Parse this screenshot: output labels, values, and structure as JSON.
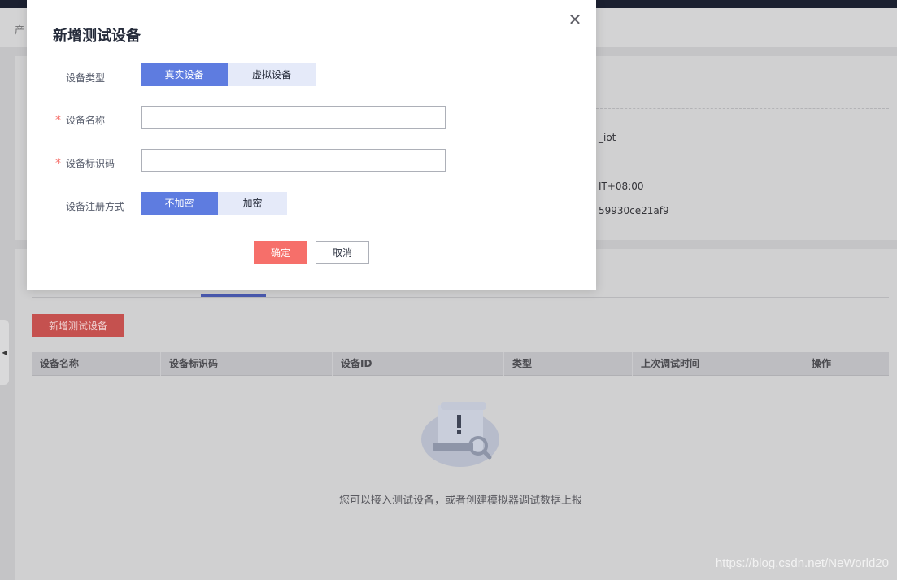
{
  "background": {
    "breadcrumb": "产",
    "info_lines": [
      "_iot",
      "IT+08:00",
      "59930ce21af9"
    ],
    "add_test_device_button": "新增测试设备",
    "table_headers": [
      "设备名称",
      "设备标识码",
      "设备ID",
      "类型",
      "上次调试时间",
      "操作"
    ],
    "empty_text": "您可以接入测试设备，或者创建模拟器调试数据上报",
    "watermark": "https://blog.csdn.net/NeWorld20"
  },
  "modal": {
    "title": "新增测试设备",
    "close_icon": "close-icon",
    "device_type": {
      "label": "设备类型",
      "options": [
        "真实设备",
        "虚拟设备"
      ],
      "selected": "真实设备"
    },
    "device_name": {
      "label": "设备名称",
      "required_mark": "*",
      "value": ""
    },
    "device_identifier": {
      "label": "设备标识码",
      "required_mark": "*",
      "value": ""
    },
    "registration_method": {
      "label": "设备注册方式",
      "options": [
        "不加密",
        "加密"
      ],
      "selected": "不加密"
    },
    "confirm_button": "确定",
    "cancel_button": "取消"
  },
  "colors": {
    "accent": "#5e7ce0",
    "danger": "#f66f6a",
    "segment_inactive": "#e5eaf9"
  }
}
